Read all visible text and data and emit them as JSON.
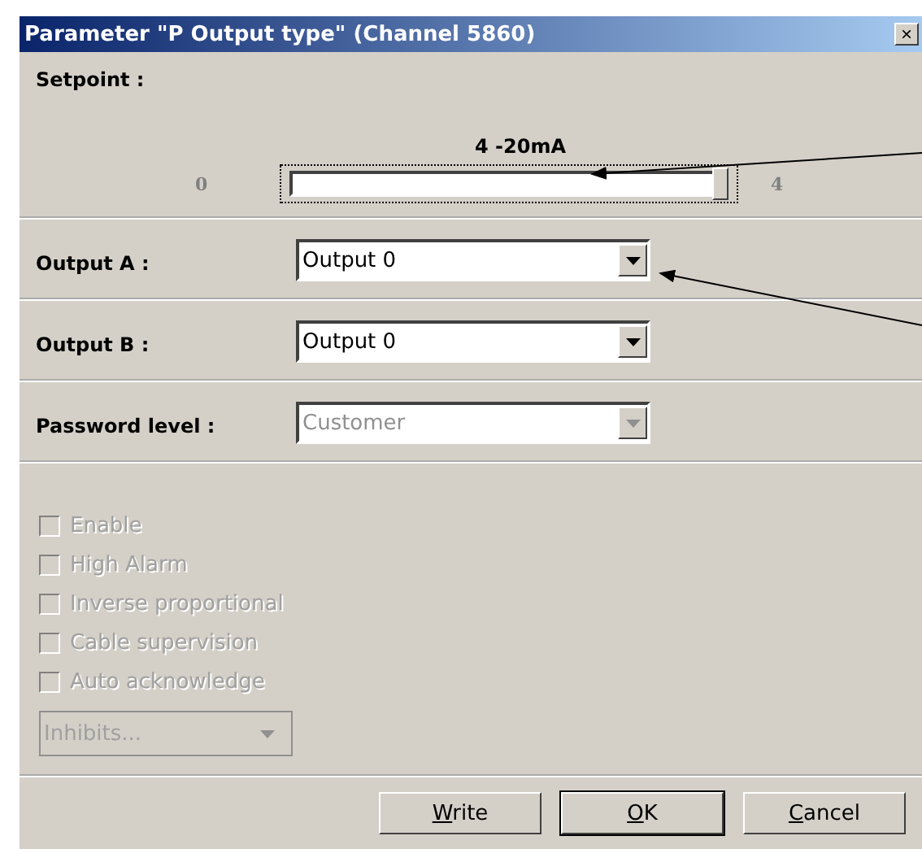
{
  "window": {
    "title": "Parameter \"P Output type\" (Channel 5860)",
    "close": "×"
  },
  "setpoint": {
    "label": "Setpoint :",
    "caption": "4 -20mA",
    "min": "0",
    "max": "4",
    "level": 1
  },
  "selects": [
    {
      "label": "Output A :",
      "value": "Output 0",
      "disabled": false
    },
    {
      "label": "Output B :",
      "value": "Output 0",
      "disabled": false
    },
    {
      "label": "Password level :",
      "value": "Customer",
      "disabled": true
    }
  ],
  "checkboxes": [
    {
      "label": "Enable",
      "checked": false,
      "disabled": true
    },
    {
      "label": "High Alarm",
      "checked": false,
      "disabled": true
    },
    {
      "label": "Inverse proportional",
      "checked": false,
      "disabled": true
    },
    {
      "label": "Cable supervision",
      "checked": false,
      "disabled": true
    },
    {
      "label": "Auto acknowledge",
      "checked": false,
      "disabled": true
    }
  ],
  "inhibits": {
    "value": "Inhibits...",
    "disabled": true
  },
  "buttons": [
    {
      "label": "Write",
      "default": false
    },
    {
      "label": "OK",
      "default": true
    },
    {
      "label": "Cancel",
      "default": false
    }
  ]
}
